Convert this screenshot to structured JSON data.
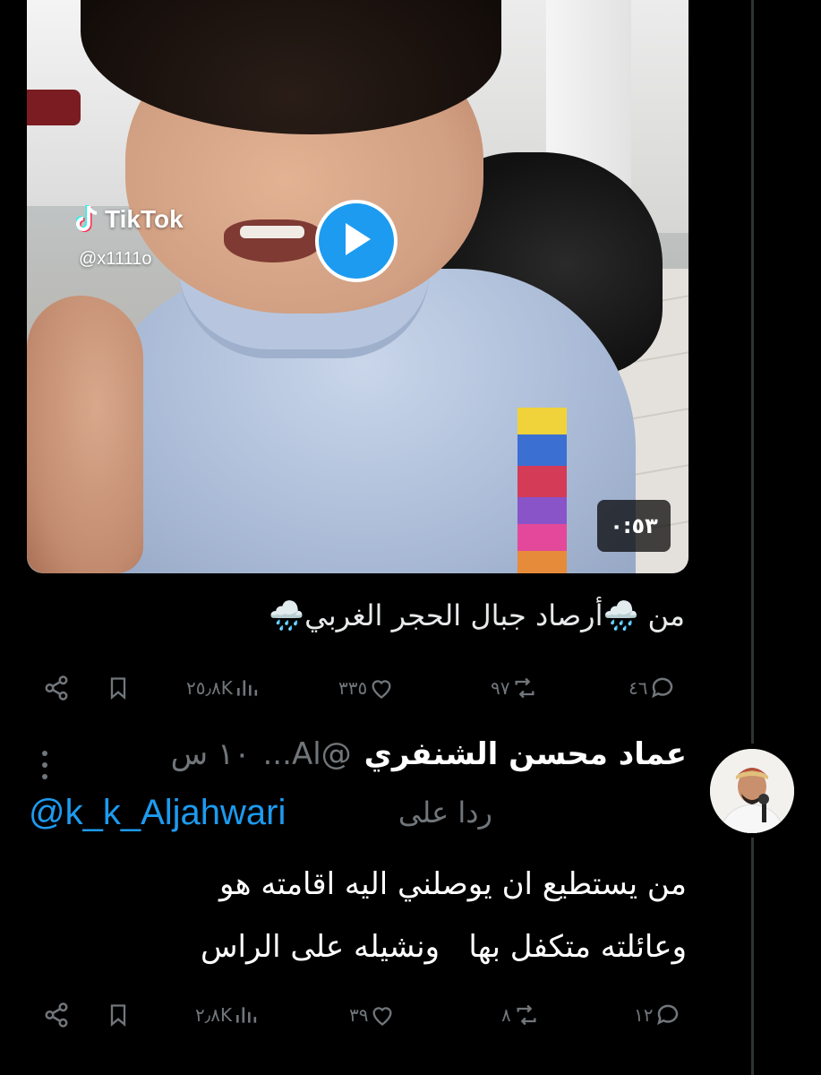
{
  "video": {
    "watermark_brand": "TikTok",
    "watermark_handle": "@x1111o",
    "duration": "٠:٥٣",
    "play_icon": "play-icon"
  },
  "tweet": {
    "text": "من 🌧️أرصاد جبال الحجر الغربي🌧️",
    "actions": {
      "replies": "٤٦",
      "reposts": "٩٧",
      "likes": "٣٣٥",
      "views": "٢٥٫٨K"
    }
  },
  "reply": {
    "author_name": "عماد محسن الشنفري",
    "author_handle": "@Al...",
    "time": "١٠ س",
    "replying_to_label": "ردا على",
    "replying_to_handle": "@k_k_Aljahwari",
    "body_line1": "من يستطيع ان يوصلني اليه اقامته هو",
    "body_line2": "وعائلته متكفل بها   ونشيله على الراس",
    "actions": {
      "replies": "١٢",
      "reposts": "٨",
      "likes": "٣٩",
      "views": "٢٫٨K"
    }
  },
  "colors": {
    "background": "#000000",
    "text": "#e7e9ea",
    "muted": "#71767b",
    "accent": "#1d9bf0"
  }
}
